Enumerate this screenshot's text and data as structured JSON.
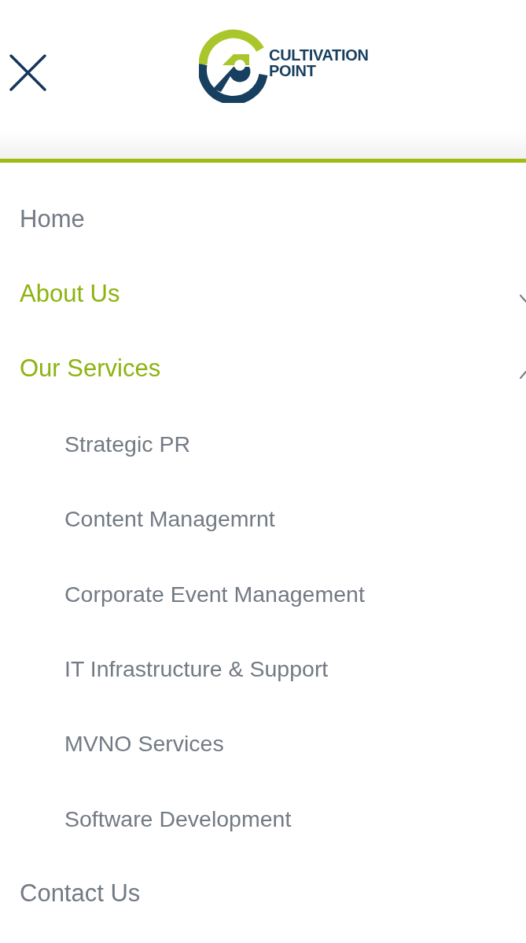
{
  "header": {
    "logo": {
      "wordmark": [
        "CULTIVATION",
        "POINT"
      ]
    }
  },
  "menu": {
    "items": [
      {
        "label": "Home",
        "kind": "link",
        "active": false
      },
      {
        "label": "About Us",
        "kind": "dropdown",
        "active": true,
        "expanded": false
      },
      {
        "label": "Our Services",
        "kind": "dropdown",
        "active": true,
        "expanded": true,
        "children": [
          {
            "label": "Strategic PR"
          },
          {
            "label": "Content Managemrnt"
          },
          {
            "label": "Corporate Event Management"
          },
          {
            "label": "IT Infrastructure & Support"
          },
          {
            "label": "MVNO Services"
          },
          {
            "label": "Software Development"
          }
        ]
      },
      {
        "label": "Contact Us",
        "kind": "link",
        "active": false
      }
    ]
  }
}
